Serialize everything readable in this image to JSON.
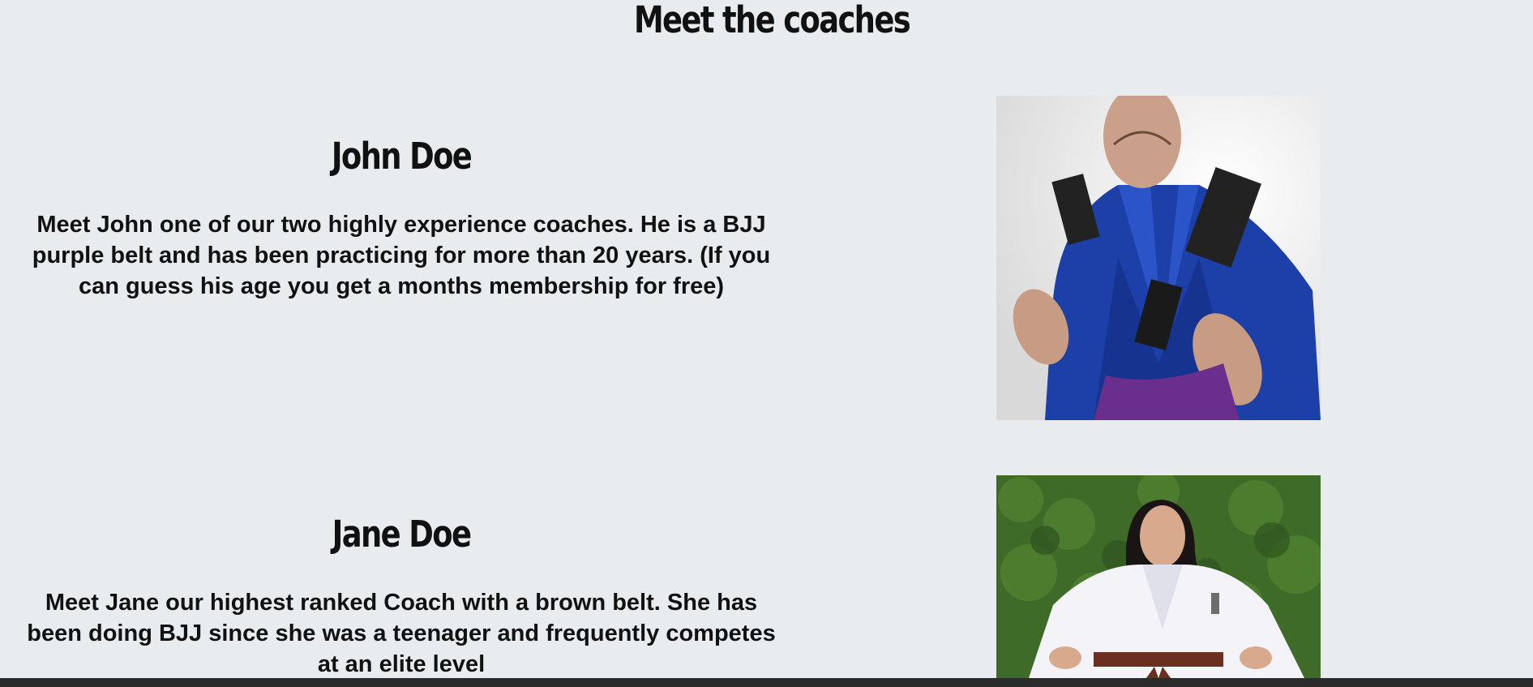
{
  "page": {
    "title": "Meet the coaches"
  },
  "coaches": [
    {
      "name": "John Doe",
      "bio": "Meet John one of our two highly experience coaches. He is a BJJ purple belt and has been practicing for more than 20 years. (If you can guess his age you get a months membership for free)"
    },
    {
      "name": "Jane Doe",
      "bio": "Meet Jane our highest ranked Coach with a brown belt. She has been doing BJJ since she was a teenager and frequently competes at an elite level"
    }
  ],
  "colors": {
    "background": "#e9ecef",
    "text": "#111111",
    "gi_blue": "#1c3fa8",
    "gi_white": "#f4f4f8",
    "belt_purple": "#6a2e8c",
    "belt_brown": "#6b2f22",
    "foliage": "#3f6b28"
  }
}
